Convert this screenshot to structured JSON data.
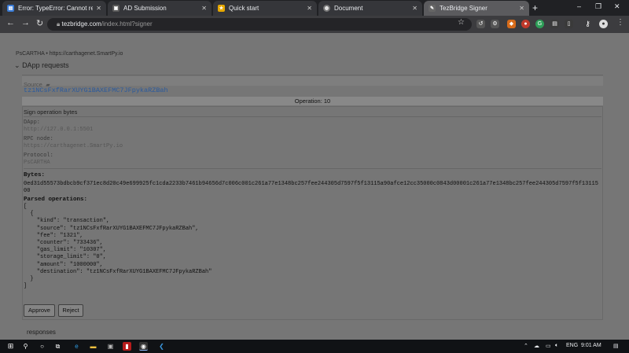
{
  "tabs": [
    {
      "title": "Error: TypeError: Cannot read p",
      "favicon": "sheets-icon",
      "color": "#3a7bd5"
    },
    {
      "title": "AD Submission",
      "favicon": "doc-icon",
      "color": "#5a5a5a"
    },
    {
      "title": "Quick start",
      "favicon": "star-icon",
      "color": "#e6a800"
    },
    {
      "title": "Document",
      "favicon": "globe-icon",
      "color": "#777"
    },
    {
      "title": "TezBridge Signer",
      "favicon": "sign-icon",
      "color": "#777",
      "active": true
    }
  ],
  "window_controls": {
    "minimize": "–",
    "maximize": "❐",
    "close": "✕"
  },
  "url": {
    "host": "tezbridge.com",
    "path": "/index.html?signer"
  },
  "network_line": "PsCARTHA • https://carthagenet.SmartPy.io",
  "dapp_requests_heading": "DApp requests",
  "source_label": "Source",
  "source_address": "tz1NCsFxfRarXUYG1BAXEFMC7JFpykaRZBah",
  "operation_label": "Operation: 10",
  "sign_label": "Sign operation bytes",
  "meta": {
    "dapp_label": "DApp:",
    "dapp_value": "http://127.0.0.1:5501",
    "rpc_label": "RPC node:",
    "rpc_value": "https://carthagenet.SmartPy.io",
    "protocol_label": "Protocol:",
    "protocol_value": "PsCARTHA"
  },
  "bytes_label": "Bytes:",
  "bytes_value": "0ed31d55573bdbcb9cf371ec8d20c49e699925fc1cda2233b7461b94656d7c006c001c261a77e1348bc257fee244305d7597f5f13115a90afce12cc35000c0843d00001c261a77e1348bc257fee244305d7597f5f1311500",
  "parsed_label": "Parsed operations:",
  "parsed_json": "[\n  {\n    \"kind\": \"transaction\",\n    \"source\": \"tz1NCsFxfRarXUYG1BAXEFMC7JFpykaRZBah\",\n    \"fee\": \"1321\",\n    \"counter\": \"733436\",\n    \"gas_limit\": \"10307\",\n    \"storage_limit\": \"0\",\n    \"amount\": \"1000000\",\n    \"destination\": \"tz1NCsFxfRarXUYG1BAXEFMC7JFpykaRZBah\"\n  }\n]",
  "approve_label": "Approve",
  "reject_label": "Reject",
  "responses_label": "responses",
  "taskbar": {
    "time": "9:01 AM",
    "lang": "ENG"
  }
}
